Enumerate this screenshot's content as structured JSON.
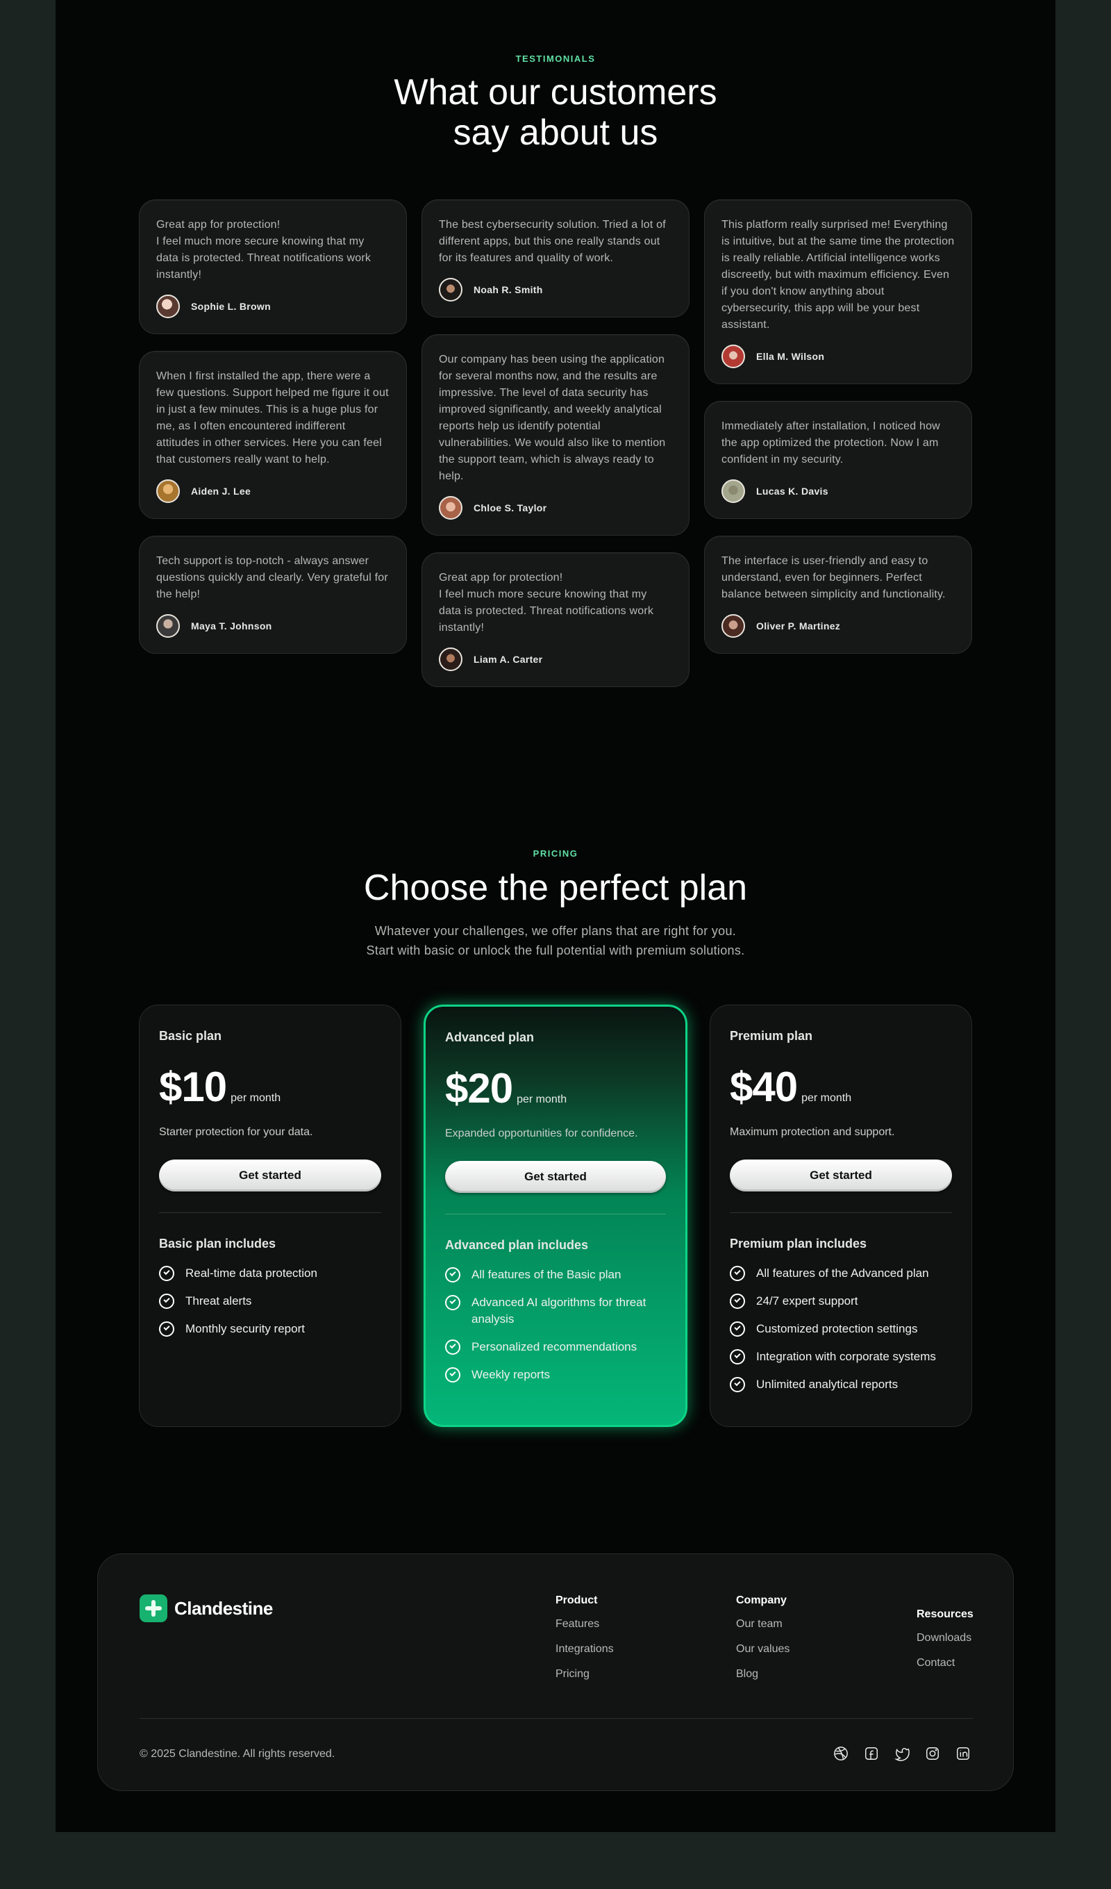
{
  "testimonials": {
    "eyebrow": "TESTIMONIALS",
    "title": "What our customers\nsay about us",
    "items": [
      {
        "text": "Great app for protection!\nI feel much more secure knowing that my data is protected. Threat notifications work instantly!",
        "name": "Sophie L. Brown"
      },
      {
        "text": "When I first installed the app, there were a few questions. Support helped me figure it out in just a few minutes. This is a huge plus for me, as I often encountered indifferent attitudes in other services. Here you can feel that customers really want to help.",
        "name": "Aiden J. Lee"
      },
      {
        "text": "Tech support is top-notch - always answer questions quickly and clearly. Very grateful for the help!",
        "name": "Maya T. Johnson"
      },
      {
        "text": "The best cybersecurity solution. Tried a lot of different apps, but this one really stands out for its features and quality of work.",
        "name": "Noah R. Smith"
      },
      {
        "text": "Our company has been using the application for several months now, and the results are impressive. The level of data security has improved significantly, and weekly analytical reports help us identify potential vulnerabilities. We would also like to mention the support team, which is always ready to help.",
        "name": "Chloe S. Taylor"
      },
      {
        "text": "Great app for protection!\nI feel much more secure knowing that my data is protected. Threat notifications work instantly!",
        "name": "Liam A. Carter"
      },
      {
        "text": "This platform really surprised me! Everything is intuitive, but at the same time the protection is really reliable. Artificial intelligence works discreetly, but with maximum efficiency. Even if you don't know anything about cybersecurity, this app will be your best assistant.",
        "name": "Ella M. Wilson"
      },
      {
        "text": "Immediately after installation, I noticed how the app optimized the protection. Now I am confident in my security.",
        "name": "Lucas K. Davis"
      },
      {
        "text": "The interface is user-friendly and easy to understand, even for beginners. Perfect balance between simplicity and functionality.",
        "name": "Oliver P. Martinez"
      }
    ]
  },
  "pricing": {
    "eyebrow": "PRICING",
    "title": "Choose the perfect plan",
    "subtitle": "Whatever your challenges, we offer plans that are right for you.\nStart with basic or unlock the full potential with premium solutions.",
    "plans": [
      {
        "name": "Basic plan",
        "price": "$10",
        "period": "per month",
        "desc": "Starter protection for your data.",
        "cta": "Get started",
        "includes": "Basic plan includes",
        "features": [
          "Real-time data protection",
          "Threat alerts",
          "Monthly security report"
        ]
      },
      {
        "name": "Advanced plan",
        "price": "$20",
        "period": "per month",
        "desc": "Expanded opportunities for confidence.",
        "cta": "Get started",
        "includes": "Advanced plan includes",
        "features": [
          "All features of the Basic plan",
          "Advanced AI algorithms for threat analysis",
          "Personalized recommendations",
          "Weekly reports"
        ]
      },
      {
        "name": "Premium plan",
        "price": "$40",
        "period": "per month",
        "desc": "Maximum protection and support.",
        "cta": "Get started",
        "includes": "Premium plan includes",
        "features": [
          "All features of the Advanced plan",
          "24/7 expert support",
          "Customized protection settings",
          "Integration with corporate systems",
          "Unlimited analytical reports"
        ]
      }
    ]
  },
  "footer": {
    "brand": "Clandestine",
    "columns": [
      {
        "title": "Product",
        "links": [
          "Features",
          "Integrations",
          "Pricing"
        ]
      },
      {
        "title": "Company",
        "links": [
          "Our team",
          "Our values",
          "Blog"
        ]
      },
      {
        "title": "Resources",
        "links": [
          "Downloads",
          "Contact"
        ]
      }
    ],
    "copyright": "© 2025 Clandestine. All rights reserved.",
    "social": [
      "dribbble-icon",
      "facebook-icon",
      "twitter-icon",
      "instagram-icon",
      "linkedin-icon"
    ]
  },
  "colors": {
    "accent": "#5fe0a4",
    "brand": "#17b26f",
    "background": "#040605",
    "card": "#161817"
  }
}
